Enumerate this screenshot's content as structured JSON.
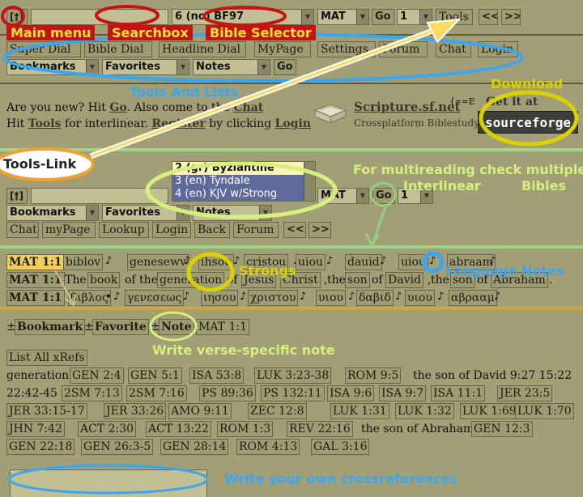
{
  "colors": {
    "bg": "#a29e75",
    "red": "#c41515",
    "yellow": "#ffdc00",
    "blue": "#3aa6ee",
    "lime": "#d6f080",
    "green": "#94ce80"
  },
  "top": {
    "glyph": "[†]",
    "version": "6 (no) BF97",
    "book": "MAT",
    "chapter": "1",
    "go": "Go",
    "tools": "Tools",
    "prev": "<<",
    "next": ">>"
  },
  "menu": [
    "Super Dial",
    "Bible Dial",
    "Headline Dial",
    "MyPage",
    "Settings",
    "Forum",
    "Chat",
    "Login"
  ],
  "lists": {
    "bookmarks": "Bookmarks",
    "favorites": "Favorites",
    "notes": "Notes",
    "go": "Go"
  },
  "intro": {
    "l1a": "Are you new? Hit ",
    "go": "Go",
    "l1b": ". Also come to the ",
    "chat": "Chat",
    "l2a": "Hit ",
    "tools": "Tools",
    "l2b": " for interlinear. ",
    "register": "Register",
    "l2c": " by clicking ",
    "login": "Login"
  },
  "brand": {
    "name": "Scripture.sf.net",
    "tag": "Crossplatform Biblestudy",
    "formula": "{∝=E",
    "get": "Get it at",
    "sf": "sourceforge"
  },
  "second": {
    "glyph": "[†]",
    "options": [
      "2 (gr) Byziantine",
      "3 (en) Tyndale",
      "4 (en) KJV w/Strong"
    ],
    "book": "MAT",
    "go": "Go",
    "chapter": "1",
    "bookmarks": "Bookmarks",
    "favorites": "Favorites",
    "notes": "Notes",
    "nav": [
      "Chat",
      "myPage",
      "Lookup",
      "Login",
      "Back",
      "Forum"
    ],
    "prev": "<<",
    "next": ">>"
  },
  "verse": {
    "ref": "MAT 1:1",
    "row1": [
      "biblov",
      "genesewv",
      "ihsou",
      "cristou",
      "uiou",
      "dauid",
      "uiou",
      "abraam"
    ],
    "row2": [
      "The",
      "book",
      "of the",
      "generation",
      "of",
      "Jesus",
      "Christ",
      ",",
      "the",
      "son",
      "of",
      "David",
      ",",
      "the",
      "son",
      "of",
      "Abraham",
      "."
    ],
    "row3": [
      "βιβλος",
      "•",
      "γενεσεως",
      "ιησου",
      "χριστου",
      "υιου",
      "δαβιδ",
      "υιου",
      "αβρααμ"
    ]
  },
  "toolbar": {
    "pm": "±",
    "bookmark": "Bookmark",
    "favorite": "Favorite",
    "note": "Note",
    "ref": "MAT 1:1"
  },
  "xrefs": {
    "title": "List All xRefs",
    "l1": "generation",
    "refs1": [
      "GEN 2:4",
      "GEN 5:1",
      "ISA 53:8",
      "LUK 3:23-38",
      "ROM 9:5"
    ],
    "david": "the son of David 9:27 15:22",
    "l2": "22:42-45",
    "refs2": [
      "2SM 7:13",
      "2SM 7:16",
      "PS 89:36",
      "PS 132:11",
      "ISA 9:6",
      "ISA 9:7",
      "ISA 11:1",
      "JER 23:5"
    ],
    "refs3": [
      "JER 33:15-17",
      "JER 33:26",
      "AMO 9:11",
      "ZEC 12:8",
      "LUK 1:31",
      "LUK 1:32",
      "LUK 1:69",
      "LUK 1:70"
    ],
    "refs4": [
      "JHN 7:42",
      "ACT 2:30",
      "ACT 13:22",
      "ROM 1:3",
      "REV 22:16"
    ],
    "abraham": "the son of Abraham",
    "refs4b": [
      "GEN 12:3"
    ],
    "refs5": [
      "GEN 22:18",
      "GEN 26:3-5",
      "GEN 28:14",
      "ROM 4:13",
      "GAL 3:16"
    ]
  },
  "annotations": {
    "main_menu": "Main menu",
    "searchbox": "Searchbox",
    "bible_selector": "Bible Selector",
    "tools_lists": "Tools And Lists",
    "download": "Download",
    "tools_link": "Tools-Link",
    "multi1": "For multireading check multiple",
    "interlinear": "Interlinear",
    "bibles": "Bibles",
    "strongs": "Strongs",
    "lang_notes": "Language Notes",
    "verse_note": "Write verse-specific note",
    "crossrefs": "Write your own crossreferences"
  }
}
